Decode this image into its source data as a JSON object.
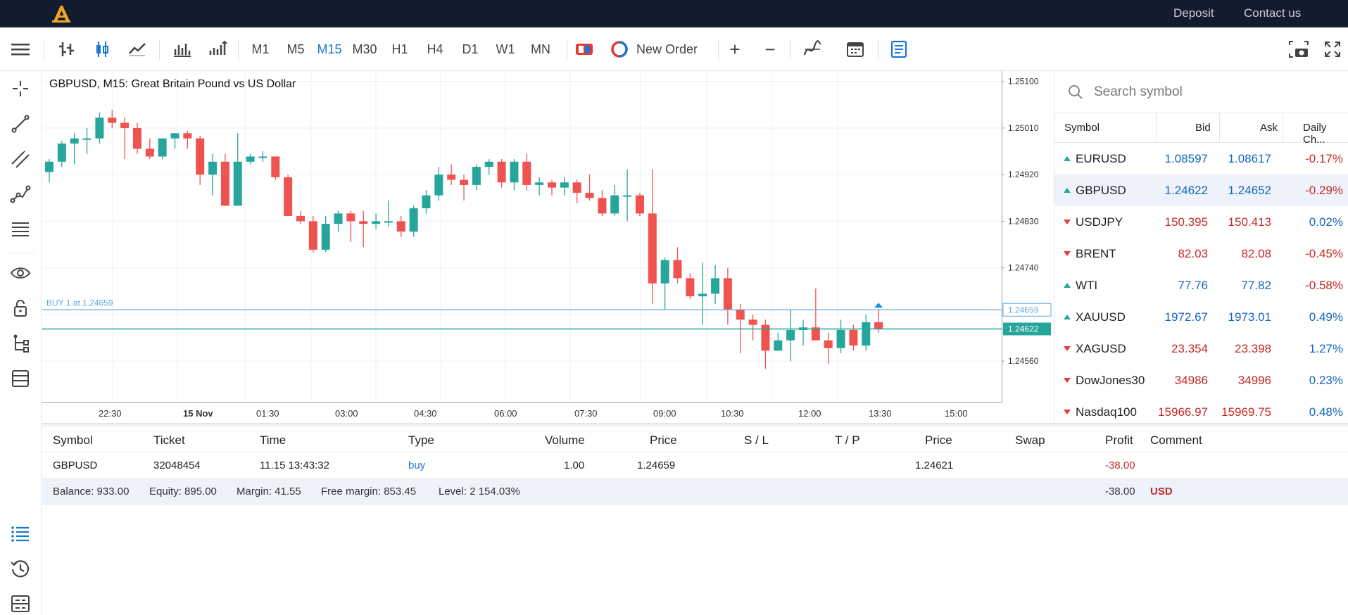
{
  "topbar": {
    "deposit": "Deposit",
    "contact": "Contact us"
  },
  "toolbar": {
    "timeframes": [
      "M1",
      "M5",
      "M15",
      "M30",
      "H1",
      "H4",
      "D1",
      "W1",
      "MN"
    ],
    "active_timeframe": "M15",
    "new_order": "New Order",
    "zoom_in": "+",
    "zoom_out": "−"
  },
  "chart": {
    "title": "GBPUSD, M15: Great Britain Pound vs US Dollar",
    "order_line_label": "BUY 1 at 1.24659",
    "order_price_tag": "1.24659",
    "bid_price_tag": "1.24622",
    "price_ticks": [
      "1.25100",
      "1.25010",
      "1.24920",
      "1.24830",
      "1.24740",
      "1.24650",
      "1.24560"
    ],
    "time_ticks": [
      "22:30",
      "15 Nov",
      "01:30",
      "03:00",
      "04:30",
      "06:00",
      "07:30",
      "09:00",
      "10:30",
      "12:00",
      "13:30",
      "15:00"
    ],
    "colors": {
      "bull": "#26a69a",
      "bear": "#ef5350",
      "order_line": "#64a8e0",
      "bid_line": "#26a69a"
    }
  },
  "chart_data": {
    "type": "candlestick",
    "title": "GBPUSD, M15: Great Britain Pound vs US Dollar",
    "ylim": [
      1.2448,
      1.2512
    ],
    "candles": [
      {
        "o": 1.24925,
        "h": 1.2495,
        "l": 1.24905,
        "c": 1.24945
      },
      {
        "o": 1.24945,
        "h": 1.24985,
        "l": 1.24935,
        "c": 1.2498
      },
      {
        "o": 1.2498,
        "h": 1.25,
        "l": 1.2494,
        "c": 1.2499
      },
      {
        "o": 1.2499,
        "h": 1.2501,
        "l": 1.2496,
        "c": 1.2499
      },
      {
        "o": 1.2499,
        "h": 1.2504,
        "l": 1.2498,
        "c": 1.2503
      },
      {
        "o": 1.2503,
        "h": 1.25045,
        "l": 1.2501,
        "c": 1.2502
      },
      {
        "o": 1.2502,
        "h": 1.2503,
        "l": 1.2495,
        "c": 1.2501
      },
      {
        "o": 1.2501,
        "h": 1.2502,
        "l": 1.2496,
        "c": 1.2497
      },
      {
        "o": 1.2497,
        "h": 1.2499,
        "l": 1.2495,
        "c": 1.24955
      },
      {
        "o": 1.24955,
        "h": 1.2499,
        "l": 1.2495,
        "c": 1.2499
      },
      {
        "o": 1.2499,
        "h": 1.25,
        "l": 1.2497,
        "c": 1.25
      },
      {
        "o": 1.25,
        "h": 1.25005,
        "l": 1.2497,
        "c": 1.2499
      },
      {
        "o": 1.2499,
        "h": 1.24995,
        "l": 1.249,
        "c": 1.2492
      },
      {
        "o": 1.2492,
        "h": 1.2496,
        "l": 1.2488,
        "c": 1.24945
      },
      {
        "o": 1.24945,
        "h": 1.2496,
        "l": 1.2486,
        "c": 1.2486
      },
      {
        "o": 1.2486,
        "h": 1.25,
        "l": 1.2486,
        "c": 1.24945
      },
      {
        "o": 1.24945,
        "h": 1.2496,
        "l": 1.2494,
        "c": 1.24955
      },
      {
        "o": 1.24955,
        "h": 1.24965,
        "l": 1.24945,
        "c": 1.24955
      },
      {
        "o": 1.24955,
        "h": 1.24955,
        "l": 1.2491,
        "c": 1.24915
      },
      {
        "o": 1.24915,
        "h": 1.2492,
        "l": 1.2484,
        "c": 1.2484
      },
      {
        "o": 1.2484,
        "h": 1.2485,
        "l": 1.24825,
        "c": 1.2483
      },
      {
        "o": 1.2483,
        "h": 1.2484,
        "l": 1.2477,
        "c": 1.24775
      },
      {
        "o": 1.24775,
        "h": 1.2484,
        "l": 1.2477,
        "c": 1.24825
      },
      {
        "o": 1.24825,
        "h": 1.2485,
        "l": 1.2481,
        "c": 1.24845
      },
      {
        "o": 1.24845,
        "h": 1.2485,
        "l": 1.2479,
        "c": 1.2483
      },
      {
        "o": 1.2483,
        "h": 1.2485,
        "l": 1.2478,
        "c": 1.24825
      },
      {
        "o": 1.24825,
        "h": 1.24845,
        "l": 1.24815,
        "c": 1.2483
      },
      {
        "o": 1.2483,
        "h": 1.2487,
        "l": 1.2482,
        "c": 1.2483
      },
      {
        "o": 1.2483,
        "h": 1.2484,
        "l": 1.248,
        "c": 1.2481
      },
      {
        "o": 1.2481,
        "h": 1.2486,
        "l": 1.248,
        "c": 1.24855
      },
      {
        "o": 1.24855,
        "h": 1.2489,
        "l": 1.24845,
        "c": 1.2488
      },
      {
        "o": 1.2488,
        "h": 1.24935,
        "l": 1.2487,
        "c": 1.2492
      },
      {
        "o": 1.2492,
        "h": 1.2494,
        "l": 1.249,
        "c": 1.2491
      },
      {
        "o": 1.2491,
        "h": 1.2492,
        "l": 1.2487,
        "c": 1.249
      },
      {
        "o": 1.249,
        "h": 1.2494,
        "l": 1.2489,
        "c": 1.24935
      },
      {
        "o": 1.24935,
        "h": 1.2495,
        "l": 1.2492,
        "c": 1.24945
      },
      {
        "o": 1.24945,
        "h": 1.2495,
        "l": 1.24895,
        "c": 1.24905
      },
      {
        "o": 1.24905,
        "h": 1.2495,
        "l": 1.2489,
        "c": 1.24945
      },
      {
        "o": 1.24945,
        "h": 1.2496,
        "l": 1.2489,
        "c": 1.249
      },
      {
        "o": 1.249,
        "h": 1.24915,
        "l": 1.2488,
        "c": 1.24905
      },
      {
        "o": 1.24905,
        "h": 1.2491,
        "l": 1.2488,
        "c": 1.24895
      },
      {
        "o": 1.24895,
        "h": 1.24915,
        "l": 1.2488,
        "c": 1.24905
      },
      {
        "o": 1.24905,
        "h": 1.2491,
        "l": 1.24865,
        "c": 1.24885
      },
      {
        "o": 1.24885,
        "h": 1.2492,
        "l": 1.2487,
        "c": 1.24875
      },
      {
        "o": 1.24875,
        "h": 1.2489,
        "l": 1.2484,
        "c": 1.24845
      },
      {
        "o": 1.24845,
        "h": 1.249,
        "l": 1.2484,
        "c": 1.2488
      },
      {
        "o": 1.2488,
        "h": 1.2493,
        "l": 1.2483,
        "c": 1.2488
      },
      {
        "o": 1.2488,
        "h": 1.24885,
        "l": 1.2484,
        "c": 1.24845
      },
      {
        "o": 1.24845,
        "h": 1.2493,
        "l": 1.2467,
        "c": 1.2471
      },
      {
        "o": 1.2471,
        "h": 1.2476,
        "l": 1.2466,
        "c": 1.24755
      },
      {
        "o": 1.24755,
        "h": 1.2478,
        "l": 1.2471,
        "c": 1.2472
      },
      {
        "o": 1.2472,
        "h": 1.2473,
        "l": 1.2468,
        "c": 1.24685
      },
      {
        "o": 1.24685,
        "h": 1.2475,
        "l": 1.2463,
        "c": 1.2469
      },
      {
        "o": 1.2469,
        "h": 1.24745,
        "l": 1.2467,
        "c": 1.2472
      },
      {
        "o": 1.2472,
        "h": 1.2474,
        "l": 1.2463,
        "c": 1.2466
      },
      {
        "o": 1.2466,
        "h": 1.2467,
        "l": 1.24575,
        "c": 1.2464
      },
      {
        "o": 1.2464,
        "h": 1.2465,
        "l": 1.246,
        "c": 1.2463
      },
      {
        "o": 1.2463,
        "h": 1.2464,
        "l": 1.24545,
        "c": 1.2458
      },
      {
        "o": 1.2458,
        "h": 1.24615,
        "l": 1.2458,
        "c": 1.246
      },
      {
        "o": 1.246,
        "h": 1.2466,
        "l": 1.2456,
        "c": 1.2462
      },
      {
        "o": 1.2462,
        "h": 1.2464,
        "l": 1.2459,
        "c": 1.24625
      },
      {
        "o": 1.24625,
        "h": 1.247,
        "l": 1.246,
        "c": 1.246
      },
      {
        "o": 1.246,
        "h": 1.24615,
        "l": 1.24555,
        "c": 1.24585
      },
      {
        "o": 1.24585,
        "h": 1.2464,
        "l": 1.24575,
        "c": 1.2462
      },
      {
        "o": 1.2462,
        "h": 1.2463,
        "l": 1.2458,
        "c": 1.2459
      },
      {
        "o": 1.2459,
        "h": 1.2465,
        "l": 1.2458,
        "c": 1.24635
      },
      {
        "o": 1.24635,
        "h": 1.2466,
        "l": 1.24615,
        "c": 1.24622
      }
    ],
    "order_line": 1.24659,
    "bid_line": 1.24622
  },
  "symbols_panel": {
    "search_placeholder": "Search symbol",
    "columns": [
      "Symbol",
      "Bid",
      "Ask",
      "Daily Ch..."
    ],
    "rows": [
      {
        "symbol": "EURUSD",
        "bid": "1.08597",
        "ask": "1.08617",
        "change": "-0.17%",
        "dir": "up",
        "color": "blue",
        "chg_color": "red"
      },
      {
        "symbol": "GBPUSD",
        "bid": "1.24622",
        "ask": "1.24652",
        "change": "-0.29%",
        "dir": "up",
        "color": "blue",
        "chg_color": "red"
      },
      {
        "symbol": "USDJPY",
        "bid": "150.395",
        "ask": "150.413",
        "change": "0.02%",
        "dir": "down",
        "color": "red",
        "chg_color": "blue"
      },
      {
        "symbol": "BRENT",
        "bid": "82.03",
        "ask": "82.08",
        "change": "-0.45%",
        "dir": "down",
        "color": "red",
        "chg_color": "red"
      },
      {
        "symbol": "WTI",
        "bid": "77.76",
        "ask": "77.82",
        "change": "-0.58%",
        "dir": "up",
        "color": "blue",
        "chg_color": "red"
      },
      {
        "symbol": "XAUUSD",
        "bid": "1972.67",
        "ask": "1973.01",
        "change": "0.49%",
        "dir": "up",
        "color": "blue",
        "chg_color": "blue"
      },
      {
        "symbol": "XAGUSD",
        "bid": "23.354",
        "ask": "23.398",
        "change": "1.27%",
        "dir": "down",
        "color": "red",
        "chg_color": "blue"
      },
      {
        "symbol": "DowJones30",
        "bid": "34986",
        "ask": "34996",
        "change": "0.23%",
        "dir": "down",
        "color": "red",
        "chg_color": "blue"
      },
      {
        "symbol": "Nasdaq100",
        "bid": "15966.97",
        "ask": "15969.75",
        "change": "0.48%",
        "dir": "down",
        "color": "red",
        "chg_color": "blue"
      }
    ]
  },
  "positions": {
    "headers": [
      "Symbol",
      "Ticket",
      "Time",
      "Type",
      "Volume",
      "Price",
      "S / L",
      "T / P",
      "Price",
      "Swap",
      "Profit",
      "Comment"
    ],
    "row": {
      "symbol": "GBPUSD",
      "ticket": "32048454",
      "time": "11.15 13:43:32",
      "type": "buy",
      "volume": "1.00",
      "price": "1.24659",
      "sl": "",
      "tp": "",
      "cur_price": "1.24621",
      "swap": "",
      "profit": "-38.00",
      "comment": ""
    },
    "summary": {
      "balance": "Balance: 933.00",
      "equity": "Equity: 895.00",
      "margin": "Margin: 41.55",
      "free_margin": "Free margin: 853.45",
      "level": "Level: 2 154.03%",
      "profit": "-38.00",
      "currency": "USD"
    }
  }
}
